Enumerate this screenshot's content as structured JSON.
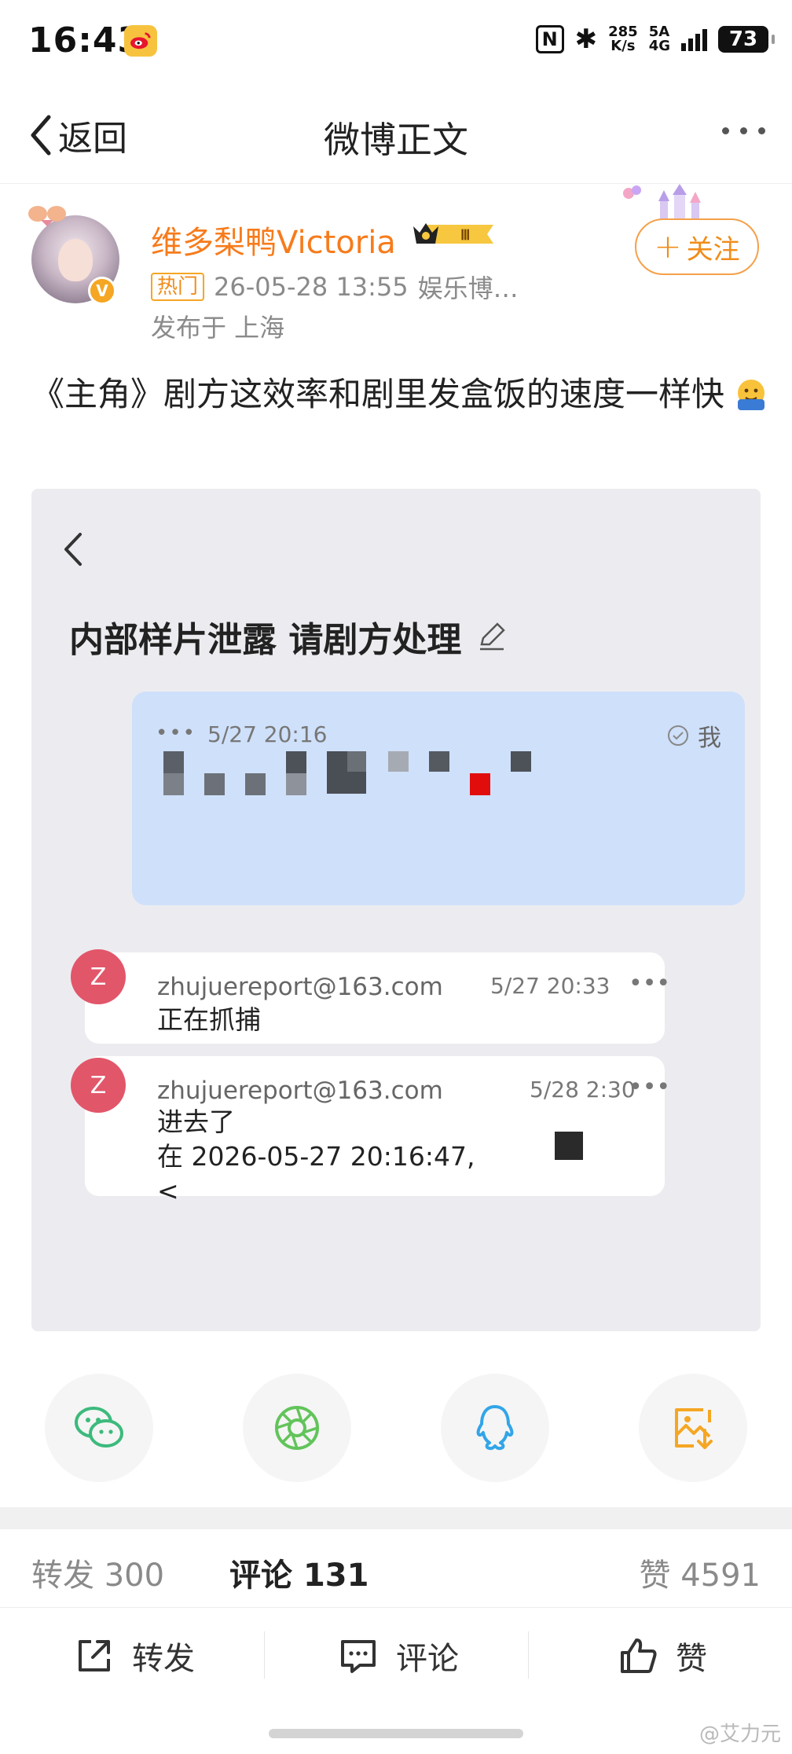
{
  "status_bar": {
    "time": "16:43",
    "nfc": "N",
    "bluetooth": "✱",
    "speed_value": "285",
    "speed_unit": "K/s",
    "network_top": "5A",
    "network_bottom": "4G",
    "battery": "73",
    "app_icon": "weibo-icon"
  },
  "nav": {
    "back_label": "返回",
    "title": "微博正文",
    "more_icon": "more-horizontal-icon"
  },
  "author": {
    "name": "维多梨鸭Victoria",
    "verified": "V",
    "level_badge": "Ⅲ",
    "hot_tag": "热门",
    "timestamp": "26-05-28 13:55",
    "source": "娱乐博…",
    "location": "发布于 上海",
    "follow_plus": "+",
    "follow_label": "关注"
  },
  "post": {
    "text": "《主角》剧方这效率和剧里发盒饭的速度一样快",
    "emoji": "saluting-face-emoji"
  },
  "embedded_image": {
    "title": "内部样片泄露 请剧方处理",
    "my_message": {
      "dots": "•••",
      "time": "5/27 20:16",
      "me_label": "我"
    },
    "replies": [
      {
        "avatar": "Z",
        "from": "zhujuereport@163.com",
        "time": "5/27 20:33",
        "dots": "•••",
        "body": "正在抓捕"
      },
      {
        "avatar": "Z",
        "from": "zhujuereport@163.com",
        "time": "5/28 2:30",
        "dots": "•••",
        "body": "进去了\n在 2026-05-27 20:16:47,\n<"
      }
    ]
  },
  "share": {
    "items": [
      "wechat-icon",
      "moments-icon",
      "qq-icon",
      "save-image-icon"
    ]
  },
  "stats": {
    "repost_label": "转发",
    "repost_count": "300",
    "comment_label": "评论",
    "comment_count": "131",
    "like_label": "赞",
    "like_count": "4591"
  },
  "actions": {
    "repost": "转发",
    "comment": "评论",
    "like": "赞"
  },
  "watermark": "@艾力元",
  "colors": {
    "accent_orange": "#f77b1b",
    "follow_border": "#f5a04a",
    "bubble_blue": "#cfe0fa",
    "avatar_red": "#e2566a",
    "wechat_green": "#3cba7c",
    "moments_green": "#62c45a",
    "qq_blue": "#32a5e8",
    "save_orange": "#f5a623"
  }
}
